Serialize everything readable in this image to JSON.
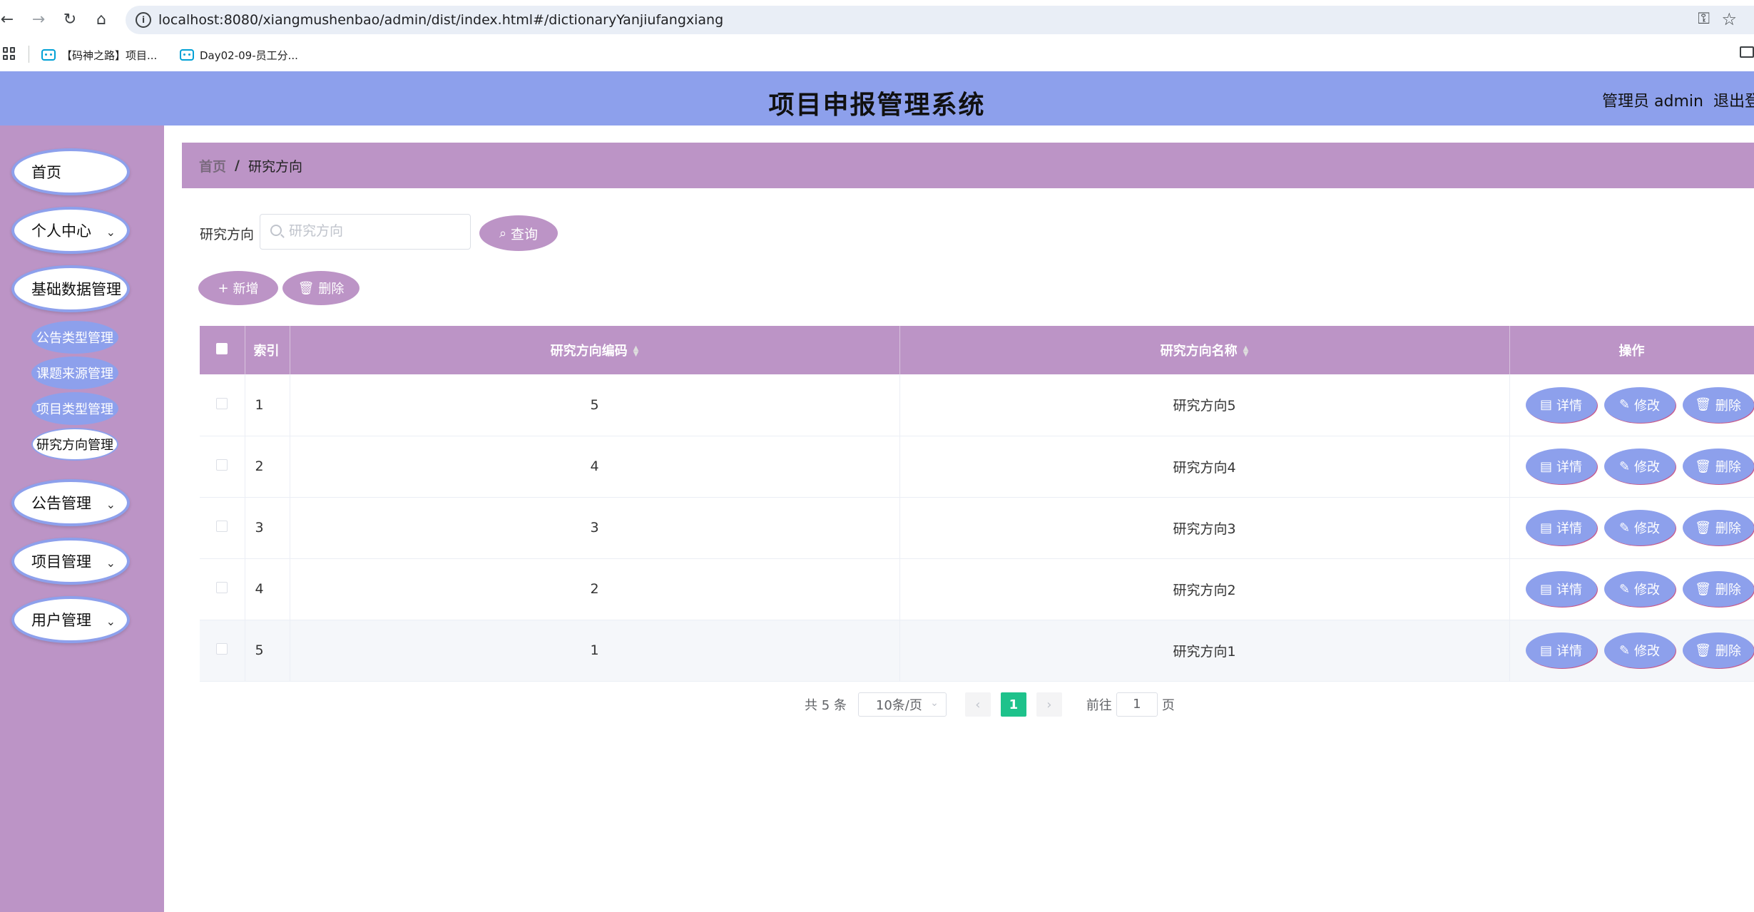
{
  "browser": {
    "url": "localhost:8080/xiangmushenbao/admin/dist/index.html#/dictionaryYanjiufangxiang",
    "bookmarks": [
      "【码神之路】项目...",
      "Day02-09-员工分..."
    ]
  },
  "header": {
    "title": "项目申报管理系统",
    "admin": "管理员 admin",
    "logout": "退出登"
  },
  "sidebar": {
    "items": [
      {
        "label": "首页"
      },
      {
        "label": "个人中心"
      },
      {
        "label": "基础数据管理"
      },
      {
        "label": "公告管理"
      },
      {
        "label": "项目管理"
      },
      {
        "label": "用户管理"
      }
    ],
    "sub_items": [
      {
        "label": "公告类型管理"
      },
      {
        "label": "课题来源管理"
      },
      {
        "label": "项目类型管理"
      },
      {
        "label": "研究方向管理"
      }
    ]
  },
  "breadcrumb": {
    "home": "首页",
    "sep": "/",
    "current": "研究方向"
  },
  "search": {
    "label": "研究方向",
    "placeholder": "研究方向",
    "query_label": "查询"
  },
  "actions": {
    "add_label": "新增",
    "delete_label": "删除"
  },
  "table": {
    "headers": {
      "index": "索引",
      "code": "研究方向编码",
      "name": "研究方向名称",
      "ops": "操作"
    },
    "rows": [
      {
        "index": "1",
        "code": "5",
        "name": "研究方向5"
      },
      {
        "index": "2",
        "code": "4",
        "name": "研究方向4"
      },
      {
        "index": "3",
        "code": "3",
        "name": "研究方向3"
      },
      {
        "index": "4",
        "code": "2",
        "name": "研究方向2"
      },
      {
        "index": "5",
        "code": "1",
        "name": "研究方向1"
      }
    ],
    "op_labels": {
      "detail": "详情",
      "edit": "修改",
      "delete": "删除"
    }
  },
  "pagination": {
    "total": "共 5 条",
    "page_size": "10条/页",
    "current_page": "1",
    "goto_label": "前往",
    "goto_value": "1",
    "page_unit": "页"
  },
  "colors": {
    "header": "#8da0ec",
    "sidebar": "#bc94c6",
    "accent": "#1ec28b"
  }
}
